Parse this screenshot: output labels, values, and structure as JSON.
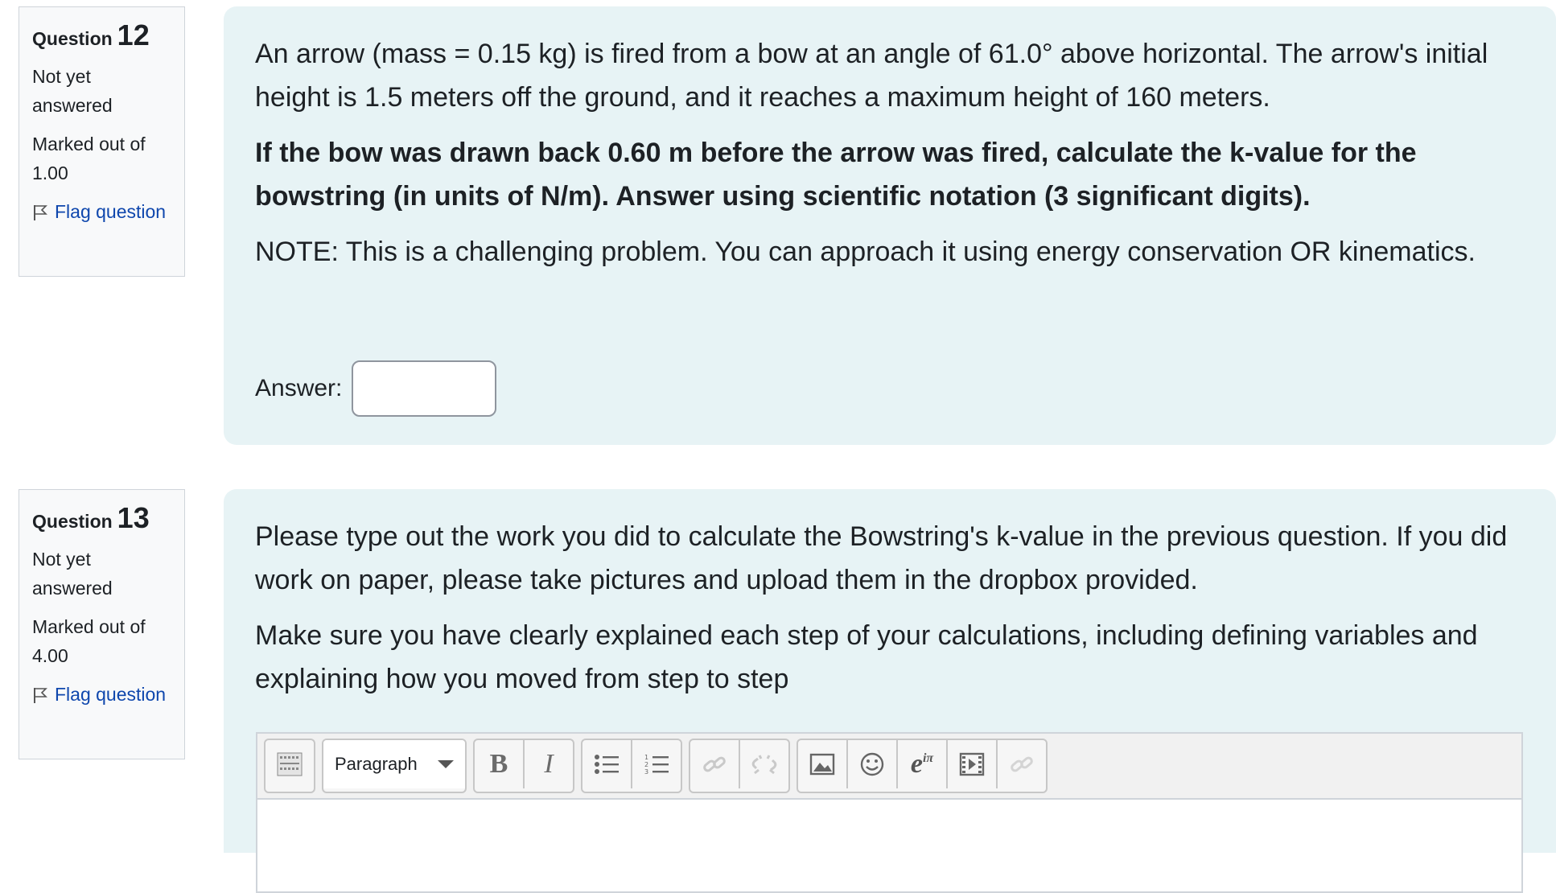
{
  "questions": [
    {
      "label": "Question",
      "number": "12",
      "state": "Not yet answered",
      "grade": "Marked out of 1.00",
      "flag_label": "Flag question",
      "text": "An arrow (mass = 0.15 kg) is fired from a bow at an angle of 61.0° above horizontal.  The arrow's initial height is 1.5 meters off the ground, and it reaches a maximum height of 160 meters.",
      "bold_text": "If the bow was drawn back 0.60 m before the arrow was fired, calculate the k-value for the bowstring (in units of N/m).  Answer using scientific notation (3 significant digits).",
      "note": "NOTE:  This is a challenging problem.  You can approach it using energy conservation OR kinematics.",
      "answer_label": "Answer:",
      "answer_value": ""
    },
    {
      "label": "Question",
      "number": "13",
      "state": "Not yet answered",
      "grade": "Marked out of 4.00",
      "flag_label": "Flag question",
      "text": "Please type out the work you did to calculate the Bowstring's k-value in the previous question.  If you did work on paper, please take pictures and upload them in the dropbox provided.",
      "text2": "Make sure you have clearly explained each step of your calculations, including defining variables and explaining how you moved from step to step"
    }
  ],
  "editor": {
    "paragraph_select": "Paragraph",
    "bold": "B",
    "italic": "I",
    "equation": "e",
    "equation_exp": "iπ",
    "icons": [
      "toolbar-toggle-icon",
      "bold-icon",
      "italic-icon",
      "unordered-list-icon",
      "ordered-list-icon",
      "link-icon",
      "unlink-icon",
      "image-icon",
      "emoji-icon",
      "equation-icon",
      "media-icon",
      "manage-files-icon"
    ],
    "content": ""
  },
  "colors": {
    "content_bg": "#e7f3f5",
    "info_bg": "#f8f9fa",
    "link": "#0f47ad"
  }
}
